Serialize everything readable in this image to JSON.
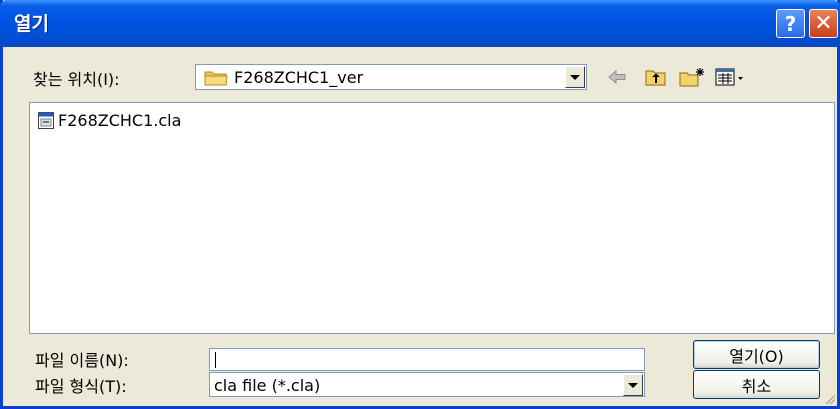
{
  "window": {
    "title": "열기",
    "help_label": "?",
    "close_label": "✕"
  },
  "lookin": {
    "label": "찾는 위치(I):",
    "value": "F268ZCHC1_ver",
    "icon": "folder-icon"
  },
  "toolbar": {
    "back_icon": "back-arrow-icon",
    "up_icon": "up-one-level-icon",
    "newfolder_icon": "new-folder-icon",
    "views_icon": "views-menu-icon"
  },
  "files": [
    {
      "name": "F268ZCHC1.cla",
      "icon": "cla-file-icon"
    }
  ],
  "filename": {
    "label": "파일 이름(N):",
    "value": ""
  },
  "filetype": {
    "label": "파일 형식(T):",
    "value": "cla file (*.cla)"
  },
  "buttons": {
    "open_label": "열기(O)",
    "cancel_label": "취소"
  },
  "colors": {
    "titlebar": "#0054e3",
    "dialog_bg": "#ece9d8",
    "border": "#7f9db9"
  }
}
